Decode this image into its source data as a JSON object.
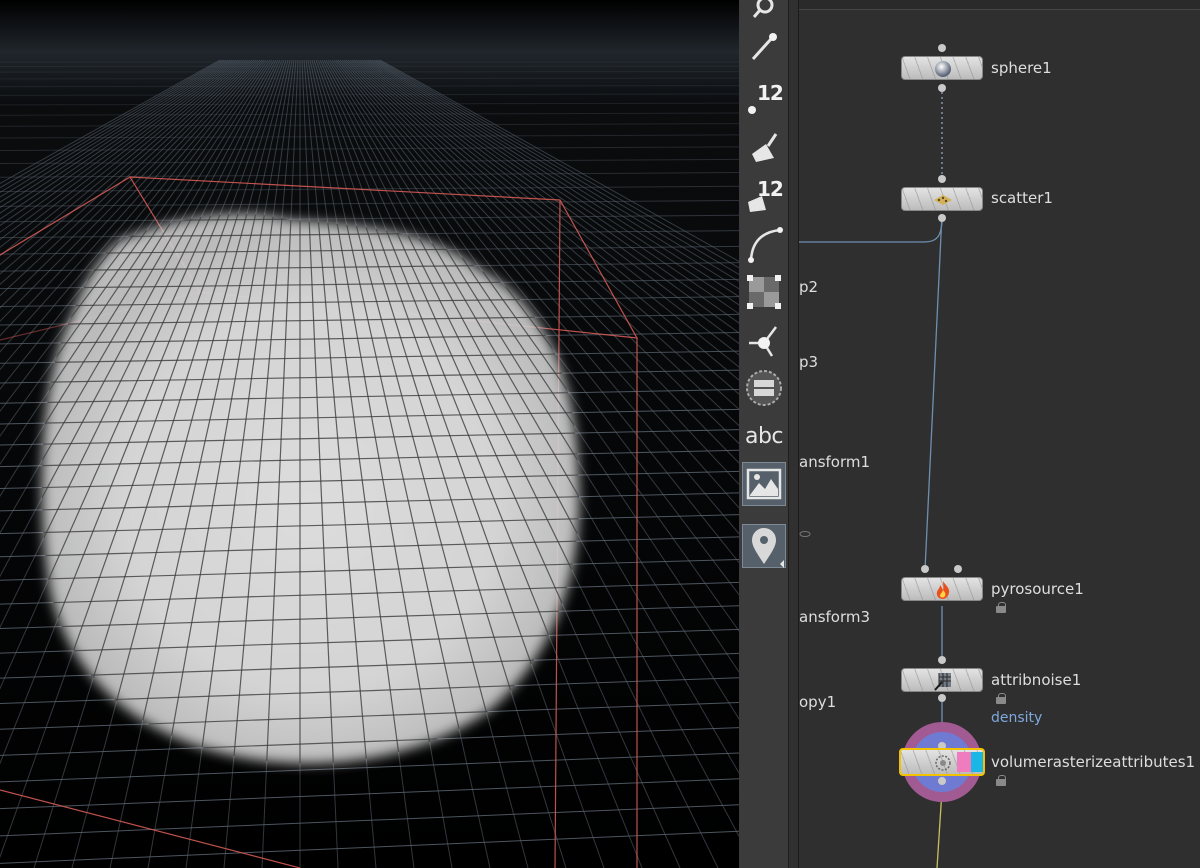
{
  "viewport": {
    "background": "#000000",
    "grid_color": "#5a6470",
    "bounding_box_color": "#d45a55",
    "volume_color": "#e8e8e8"
  },
  "toolbar": {
    "tools": [
      {
        "icon": "link-icon"
      },
      {
        "icon": "pin-icon"
      },
      {
        "icon": "point-count-icon",
        "label": "12"
      },
      {
        "icon": "brush-icon"
      },
      {
        "icon": "primitive-count-icon",
        "label": "12"
      },
      {
        "icon": "curve-icon"
      },
      {
        "icon": "checker-icon"
      },
      {
        "icon": "handle-icon"
      },
      {
        "icon": "ghost-icon"
      },
      {
        "icon": "text-icon",
        "label": "abc"
      },
      {
        "icon": "background-image-icon"
      },
      {
        "icon": "location-pin-icon"
      }
    ]
  },
  "network": {
    "partial_labels": [
      "p2",
      "p3",
      "ansform1",
      "ansform3",
      "opy1"
    ],
    "nodes": [
      {
        "name": "sphere1",
        "icon": "sphere-icon"
      },
      {
        "name": "scatter1",
        "icon": "scatter-icon"
      },
      {
        "name": "pyrosource1",
        "icon": "fire-icon",
        "locked": true
      },
      {
        "name": "attribnoise1",
        "icon": "noise-icon",
        "locked": true,
        "flag": "density"
      },
      {
        "name": "volumerasterizeattributes1",
        "icon": "volume-icon",
        "locked": true,
        "selected": true
      }
    ],
    "selection_color": "#f2c200",
    "wire_color": "#6f8fb0",
    "display_wire_color": "#c8c060"
  }
}
